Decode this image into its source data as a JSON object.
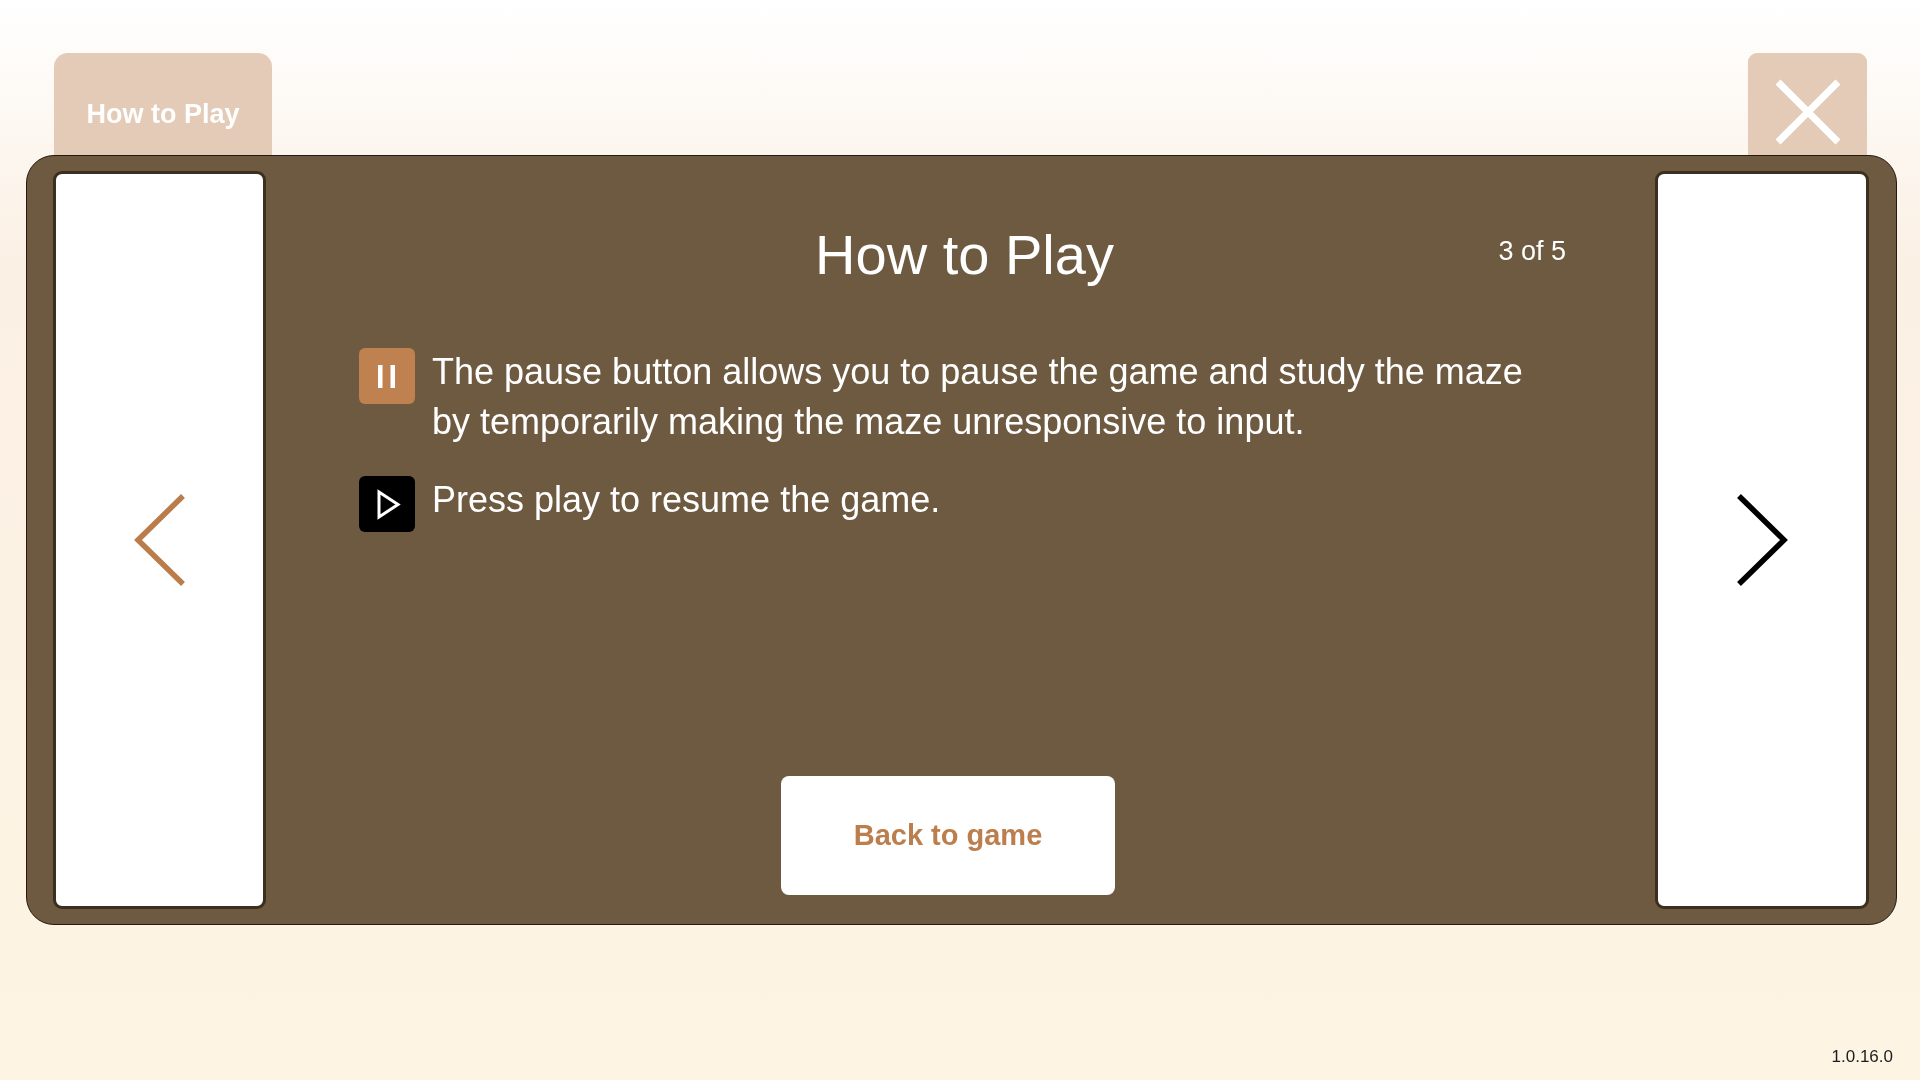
{
  "tab": {
    "label": "How to Play"
  },
  "dialog": {
    "title": "How to Play",
    "page_indicator": "3 of 5",
    "instructions": [
      {
        "kind": "pause",
        "text": "The pause button allows you to pause the game and study the maze by temporarily making the maze unresponsive to input."
      },
      {
        "kind": "play",
        "text": "Press play to resume the game."
      }
    ],
    "nav_buttons": [
      {
        "kind": "previous",
        "color": "#b97c4a"
      },
      {
        "kind": "next",
        "color": "#000000"
      }
    ],
    "back_button": {
      "label": "Back to game"
    }
  },
  "version": "1.0.16.0"
}
